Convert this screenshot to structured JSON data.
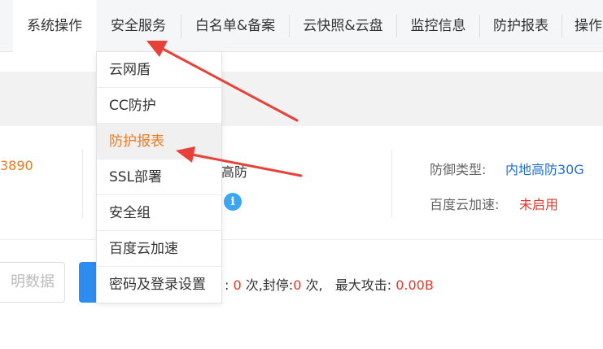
{
  "nav": {
    "tabs": [
      {
        "label": "系统操作"
      },
      {
        "label": "安全服务"
      },
      {
        "label": "白名单&备案"
      },
      {
        "label": "云快照&云盘"
      },
      {
        "label": "监控信息"
      },
      {
        "label": "防护报表"
      },
      {
        "label": "操作"
      }
    ]
  },
  "dropdown": {
    "items": [
      {
        "label": "云网盾"
      },
      {
        "label": "CC防护"
      },
      {
        "label": "防护报表"
      },
      {
        "label": "SSL部署"
      },
      {
        "label": "安全组"
      },
      {
        "label": "百度云加速"
      },
      {
        "label": "密码及登录设置"
      }
    ]
  },
  "info": {
    "partial_number": "3890",
    "partial_type_text": "高防",
    "defense_type_label": "防御类型:",
    "defense_type_value": "内地高防30G",
    "baidu_accel_label": "百度云加速:",
    "baidu_accel_value": "未启用"
  },
  "controls": {
    "date_input_partial": "明数据"
  },
  "stats": {
    "colon": ":",
    "count1": "0",
    "count1_suffix": "次,封停:",
    "count2": "0",
    "count2_suffix": "次,",
    "max_attack_label": "最大攻击:",
    "max_attack_value": "0.00B"
  },
  "colors": {
    "accent_orange": "#f07b20",
    "link_blue": "#1f6fd0",
    "value_red": "#e33a2c",
    "button_blue": "#2d8cf0",
    "annotation_arrow_red": "#e8413a"
  }
}
